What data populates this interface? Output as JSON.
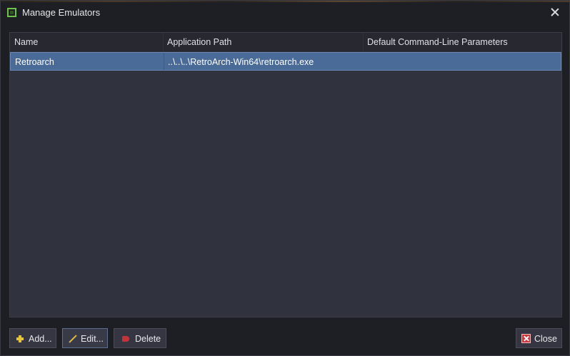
{
  "window": {
    "title": "Manage Emulators",
    "icon": "emulator-chip-icon"
  },
  "table": {
    "columns": [
      "Name",
      "Application Path",
      "Default Command-Line Parameters"
    ],
    "rows": [
      {
        "name": "Retroarch",
        "path": "..\\..\\..\\RetroArch-Win64\\retroarch.exe",
        "params": "",
        "selected": true
      }
    ]
  },
  "buttons": {
    "add": "Add...",
    "edit": "Edit...",
    "delete": "Delete",
    "close": "Close"
  },
  "colors": {
    "background": "#1e1f24",
    "grid": "#30323d",
    "header": "#272830",
    "selection": "#4a6a98",
    "accent_green": "#6fc14a"
  }
}
